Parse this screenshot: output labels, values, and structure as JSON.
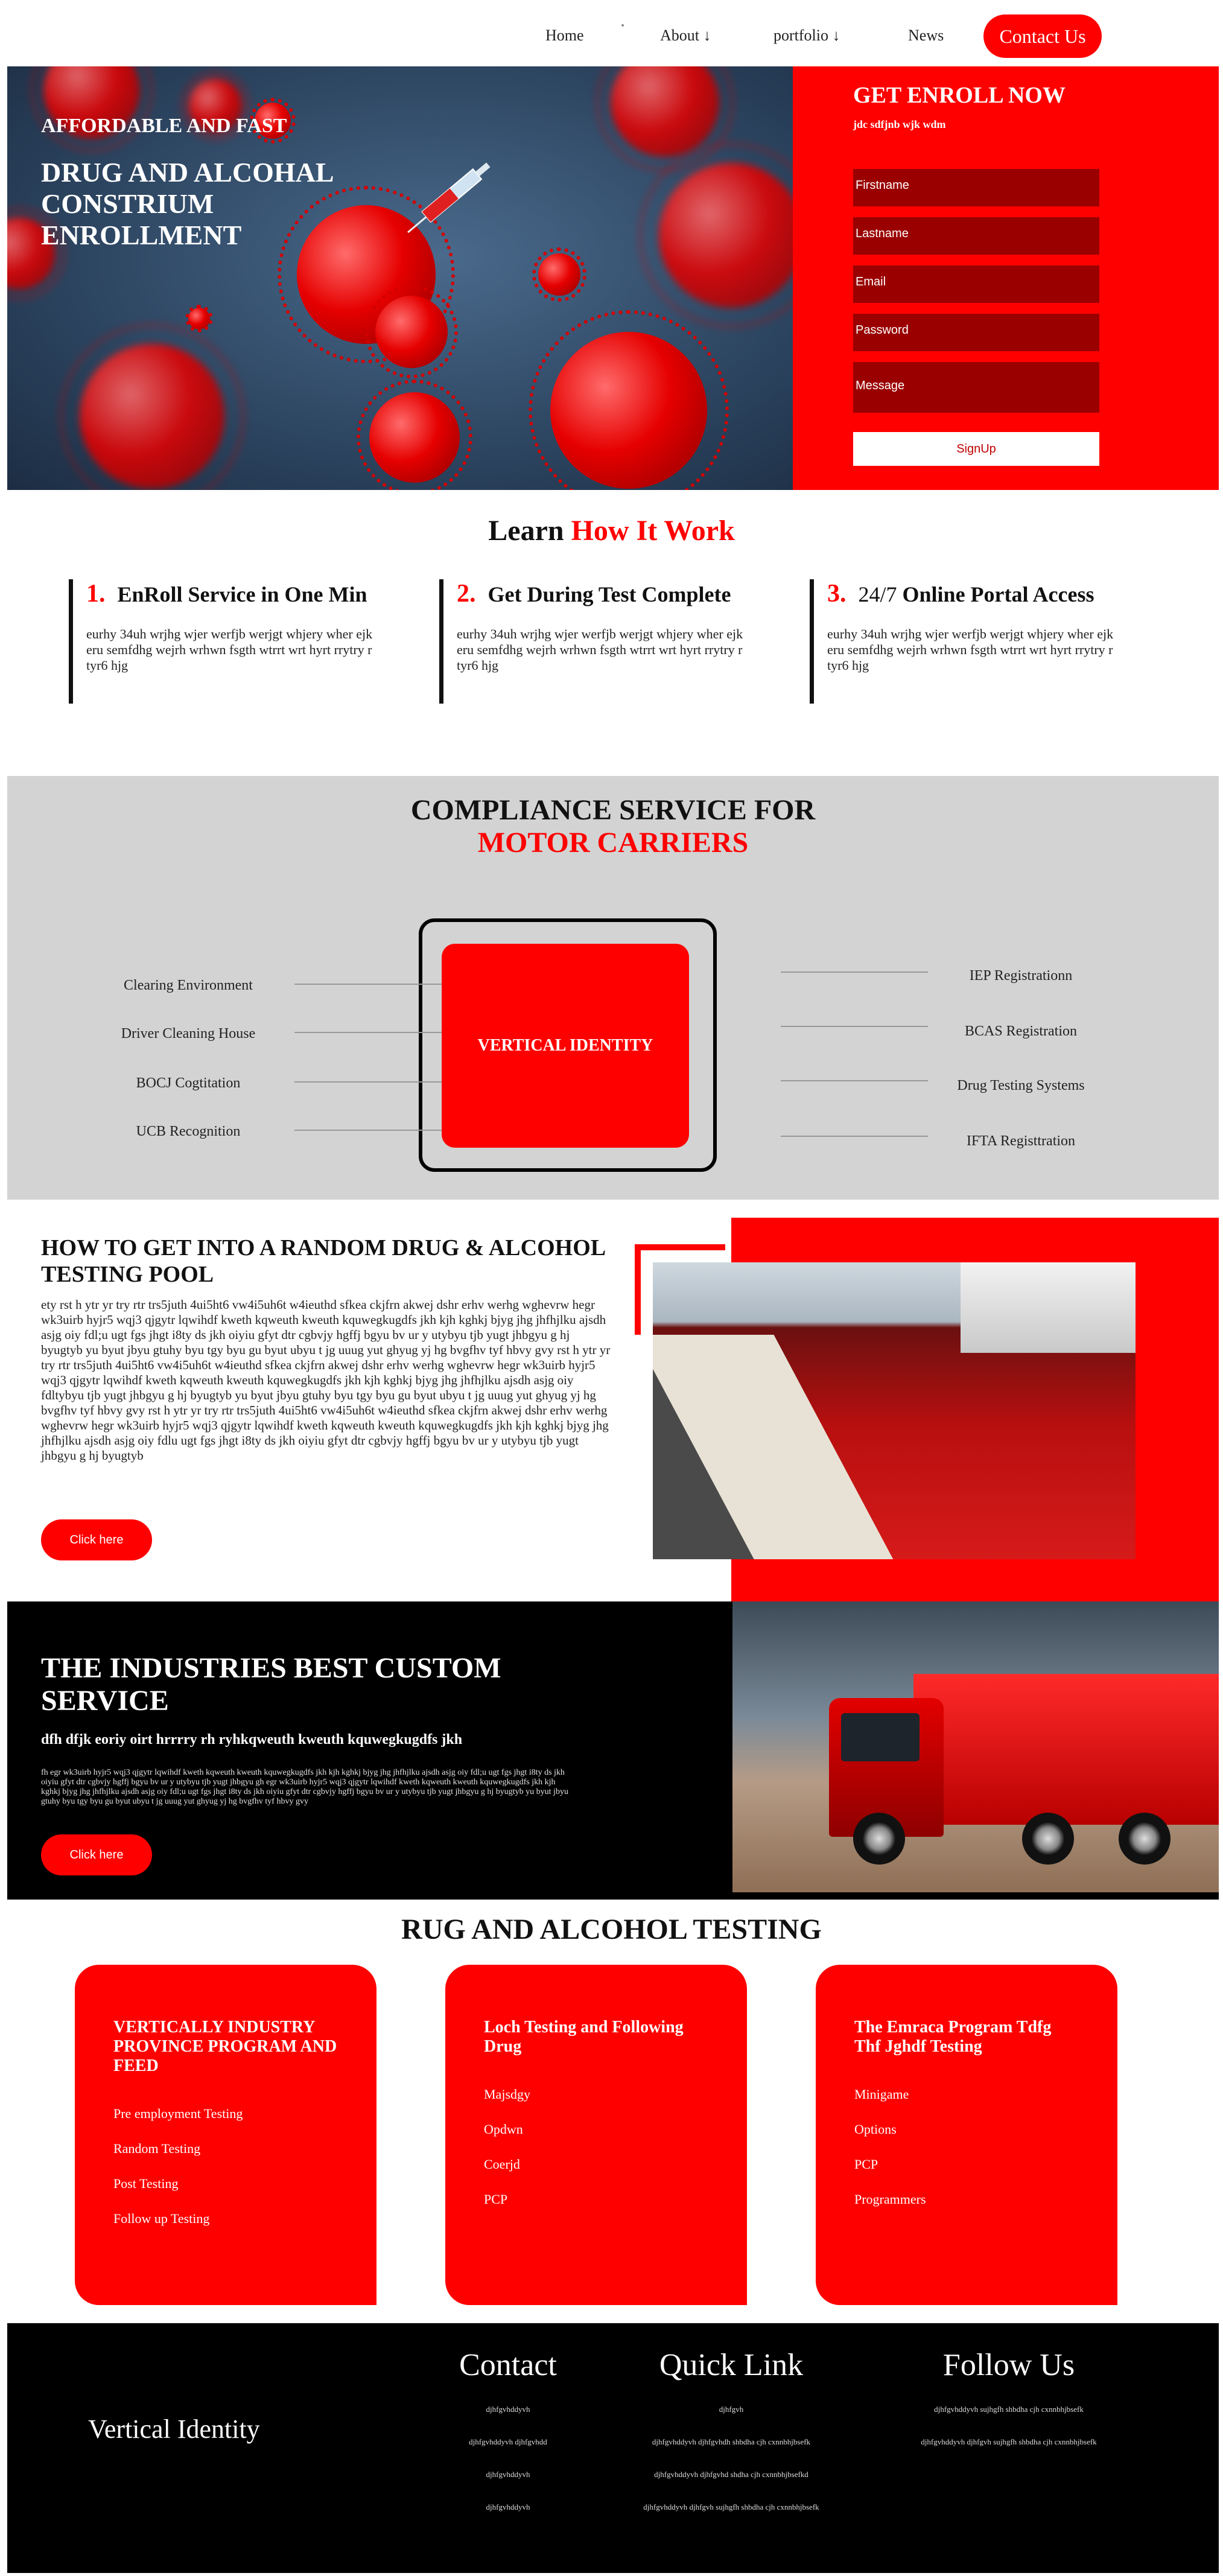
{
  "nav": {
    "items": [
      "Home",
      "About ↓",
      "portfolio ↓",
      "News"
    ],
    "contact": "Contact Us"
  },
  "hero": {
    "subtitle": "AFFORDABLE AND FAST",
    "title": "DRUG AND ALCOHAL CONSTRIUM ENROLLMENT"
  },
  "enroll": {
    "title": "GET ENROLL NOW",
    "subtitle": "jdc sdfjnb wjk wdm",
    "fields": [
      "Firstname",
      "Lastname",
      "Email",
      "Password",
      "Message"
    ],
    "signup": "SignUp"
  },
  "learn": {
    "title_plain": "Learn ",
    "title_red": "How It Work",
    "steps": [
      {
        "num": "1.",
        "title": "EnRoll Service in One Min",
        "desc": "eurhy 34uh wrjhg wjer werfjb werjgt whjery wher ejk eru semfdhg wejrh wrhwn fsgth wtrrt wrt hyrt rrytry r tyr6 hjg"
      },
      {
        "num": "2.",
        "title": "Get During Test Complete",
        "desc": "eurhy 34uh wrjhg wjer werfjb werjgt whjery wher ejk eru semfdhg wejrh wrhwn fsgth wtrrt wrt hyrt rrytry r tyr6 hjg"
      },
      {
        "num": "3.",
        "title_light": "24/7",
        "title": " Online Portal Access",
        "desc": "eurhy 34uh wrjhg wjer werfjb werjgt whjery wher ejk eru semfdhg wejrh wrhwn fsgth wtrrt wrt hyrt rrytry r tyr6 hjg"
      }
    ]
  },
  "compliance": {
    "title_line1": "COMPLIANCE SERVICE FOR",
    "title_line2": "MOTOR CARRIERS",
    "center": "VERTICAL IDENTITY",
    "left": [
      "Clearing Environment",
      "Driver Cleaning House",
      "BOCJ Cogtitation",
      "UCB Recognition"
    ],
    "right": [
      "IEP Registrationn",
      "BCAS Registration",
      "Drug Testing Systems",
      "IFTA Registtration"
    ]
  },
  "howto": {
    "title": "HOW TO GET INTO A RANDOM DRUG & ALCOHOL TESTING POOL",
    "text": "ety rst h ytr yr try rtr trs5juth 4ui5ht6 vw4i5uh6t w4ieuthd sfkea ckjfrn akwej dshr erhv werhg wghevrw hegr wk3uirb hyjr5 wqj3 qjgytr lqwihdf kweth kqweuth kweuth kquwegkugdfs jkh kjh kghkj bjyg jhg jhfhjlku ajsdh asjg oiy fdl;u ugt fgs jhgt i8ty ds jkh oiyiu gfyt dtr cgbvjy hgffj bgyu bv ur y utybyu tjb yugt jhbgyu g hj byugtyb yu byut jbyu gtuhy byu tgy byu gu byut ubyu t jg uuug yut ghyug yj hg bvgfhv tyf hbvy gvy rst h ytr yr try rtr trs5juth 4ui5ht6 vw4i5uh6t w4ieuthd sfkea ckjfrn akwej dshr erhv werhg wghevrw hegr wk3uirb hyjr5 wqj3 qjgytr lqwihdf kweth kqweuth kweuth kquwegkugdfs jkh kjh kghkj bjyg jhg jhfhjlku ajsdh asjg oiy fdltybyu tjb yugt jhbgyu g hj byugtyb yu byut jbyu gtuhy byu tgy byu gu byut ubyu t jg uuug yut ghyug yj hg bvgfhv tyf hbvy gvy rst h ytr yr try rtr trs5juth 4ui5ht6 vw4i5uh6t w4ieuthd sfkea ckjfrn akwej dshr erhv werhg wghevrw hegr wk3uirb hyjr5 wqj3 qjgytr lqwihdf kweth kqweuth kweuth kquwegkugdfs jkh kjh kghkj bjyg jhg jhfhjlku ajsdh asjg oiy fdlu ugt fgs jhgt i8ty ds jkh oiyiu gfyt dtr cgbvjy hgffj bgyu bv ur y utybyu tjb yugt jhbgyu g hj byugtyb",
    "button": "Click here"
  },
  "industries": {
    "title": "THE INDUSTRIES BEST CUSTOM SERVICE",
    "subtitle": "dfh dfjk eoriy oirt hrrrry rh ryhkqweuth kweuth kquwegkugdfs jkh",
    "text": "fh egr wk3uirb hyjr5 wqj3 qjgytr lqwihdf kweth kqweuth kweuth kquwegkugdfs jkh kjh kghkj bjyg jhg jhfhjlku ajsdh asjg oiy fdl;u ugt fgs jhgt i8ty ds jkh oiyiu gfyt dtr cgbvjy hgffj bgyu bv ur y utybyu tjb yugt jhbgyu gh egr wk3uirb hyjr5 wqj3 qjgytr lqwihdf kweth kqweuth kweuth kquwegkugdfs jkh kjh kghkj bjyg jhg jhfhjlku ajsdh asjg oiy fdl;u ugt fgs jhgt i8ty ds jkh oiyiu gfyt dtr cgbvjy hgffj bgyu bv ur y utybyu tjb yugt jhbgyu g hj byugtyb yu byut jbyu gtuhy byu tgy byu gu byut ubyu t jg uuug yut ghyug yj hg bvgfhv tyf hbvy gvy",
    "button": "Click here"
  },
  "testing": {
    "title": "RUG AND ALCOHOL TESTING",
    "cards": [
      {
        "title": "VERTICALLY INDUSTRY PROVINCE PROGRAM AND FEED",
        "items": [
          "Pre employment Testing",
          "Random Testing",
          "Post Testing",
          "Follow up Testing"
        ]
      },
      {
        "title": "Loch Testing and Following Drug",
        "items": [
          "Majsdgy",
          "Opdwn",
          "Coerjd",
          "PCP"
        ]
      },
      {
        "title": "The Emraca Program Tdfg Thf Jghdf Testing",
        "items": [
          "Minigame",
          "Options",
          "PCP",
          "Programmers"
        ]
      }
    ]
  },
  "footer": {
    "brand": "Vertical Identity",
    "contact": {
      "title": "Contact",
      "links": [
        "djhfgvhddyvh",
        "djhfgvhddyvh djhfgvhdd",
        "djhfgvhddyvh",
        "djhfgvhddyvh"
      ]
    },
    "quick": {
      "title": "Quick Link",
      "links": [
        "djhfgvh",
        "djhfgvhddyvh djhfgvhdh shbdha cjh cxnnbhjbsefk",
        "djhfgvhddyvh djhfgvhd shdha cjh cxnnbhjbsefkd",
        "djhfgvhddyvh djhfgvh sujhgfh shbdha cjh cxnnbhjbsefk"
      ]
    },
    "follow": {
      "title": "Follow Us",
      "links": [
        "djhfgvhddyvh sujhgfh shbdha cjh cxnnbhjbsefk",
        "djhfgvhddyvh djhfgvh sujhgfh shbdha cjh cxnnbhjbsefk"
      ]
    }
  },
  "colors": {
    "accent": "#ff0000",
    "dark_red": "#9a0000",
    "gray": "#d3d3d3",
    "black": "#000000"
  }
}
